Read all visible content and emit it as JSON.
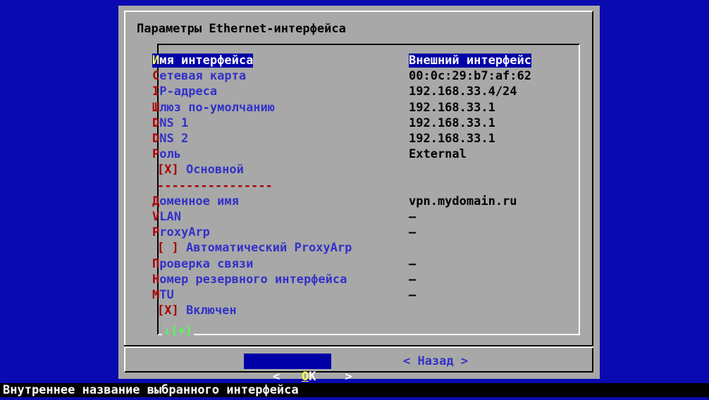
{
  "dialog": {
    "title": "Параметры Ethernet-интерфейса"
  },
  "fields": [
    {
      "hot": "И",
      "rest": "мя интерфейса",
      "value": "Внешний интерфейс",
      "selected": true
    },
    {
      "hot": "С",
      "rest": "етевая карта",
      "value": "00:0c:29:b7:af:62"
    },
    {
      "hot": "I",
      "rest": "P-адреса",
      "value": "192.168.33.4/24"
    },
    {
      "hot": "Ш",
      "rest": "люз по-умолчанию",
      "value": "192.168.33.1"
    },
    {
      "hot": "D",
      "rest": "NS 1",
      "value": "192.168.33.1"
    },
    {
      "hot": "D",
      "rest": "NS 2",
      "value": "192.168.33.1"
    },
    {
      "hot": "Р",
      "rest": "оль",
      "value": "External"
    },
    {
      "hot": "[X]",
      "rest": " Основной",
      "value": "",
      "indent": true
    },
    {
      "divider": "----------------",
      "indent": true
    },
    {
      "hot": "Д",
      "rest": "оменное имя",
      "value": "vpn.mydomain.ru"
    },
    {
      "hot": "V",
      "rest": "LAN",
      "value": "–"
    },
    {
      "hot": "P",
      "rest": "roxyArp",
      "value": "–"
    },
    {
      "hot": "[ ]",
      "rest": " Автоматический ProxyArp",
      "value": "",
      "indent": true
    },
    {
      "hot": "П",
      "rest": "роверка связи",
      "value": "–"
    },
    {
      "hot": "Н",
      "rest": "омер резервного интерфейса",
      "value": "–"
    },
    {
      "hot": "M",
      "rest": "TU",
      "value": "–"
    },
    {
      "hot": "[X]",
      "rest": " Включен",
      "value": "",
      "indent": true
    }
  ],
  "more_indicator": "↓(+)",
  "buttons": {
    "ok": {
      "left": "<",
      "hotkey": "O",
      "rest": "K",
      "right": ">"
    },
    "back": "< Назад >"
  },
  "status_bar": "Внутреннее название выбранного интерфейса",
  "colors": {
    "screen_bg": "#0a0ab0",
    "dialog_bg": "#a8a8a8",
    "hotkey_red": "#a80000",
    "item_blue": "#3232c8",
    "selection_bg": "#0000a8",
    "selection_hotkey": "#ffff54",
    "more_green": "#54fc54"
  }
}
